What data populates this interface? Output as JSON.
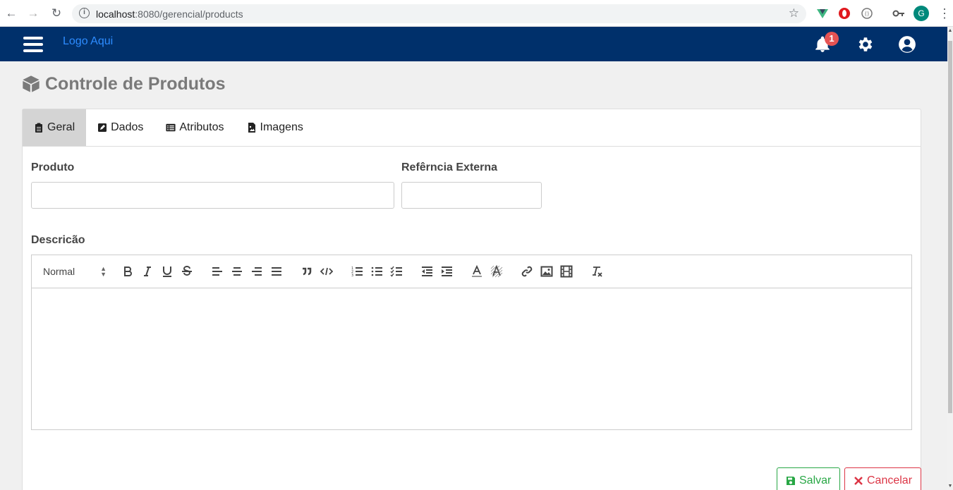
{
  "browser": {
    "url_host": "localhost",
    "url_path": ":8080/gerencial/products",
    "profile_initial": "G"
  },
  "navbar": {
    "logo_text": "Logo Aqui",
    "notification_count": "1"
  },
  "page": {
    "title": "Controle de Produtos"
  },
  "tabs": [
    {
      "label": "Geral",
      "icon": "clipboard-icon",
      "active": true
    },
    {
      "label": "Dados",
      "icon": "edit-icon",
      "active": false
    },
    {
      "label": "Atributos",
      "icon": "list-alt-icon",
      "active": false
    },
    {
      "label": "Imagens",
      "icon": "file-image-icon",
      "active": false
    }
  ],
  "form": {
    "produto_label": "Produto",
    "produto_value": "",
    "referencia_label": "Refêrncia Externa",
    "referencia_value": "",
    "descricao_label": "Descricão",
    "heading_select": "Normal"
  },
  "actions": {
    "save_label": "Salvar",
    "cancel_label": "Cancelar"
  },
  "colors": {
    "navbar": "#00306b",
    "logo": "#2d8cff",
    "badge": "#e55353",
    "save": "#28a745",
    "cancel": "#dc3545"
  }
}
